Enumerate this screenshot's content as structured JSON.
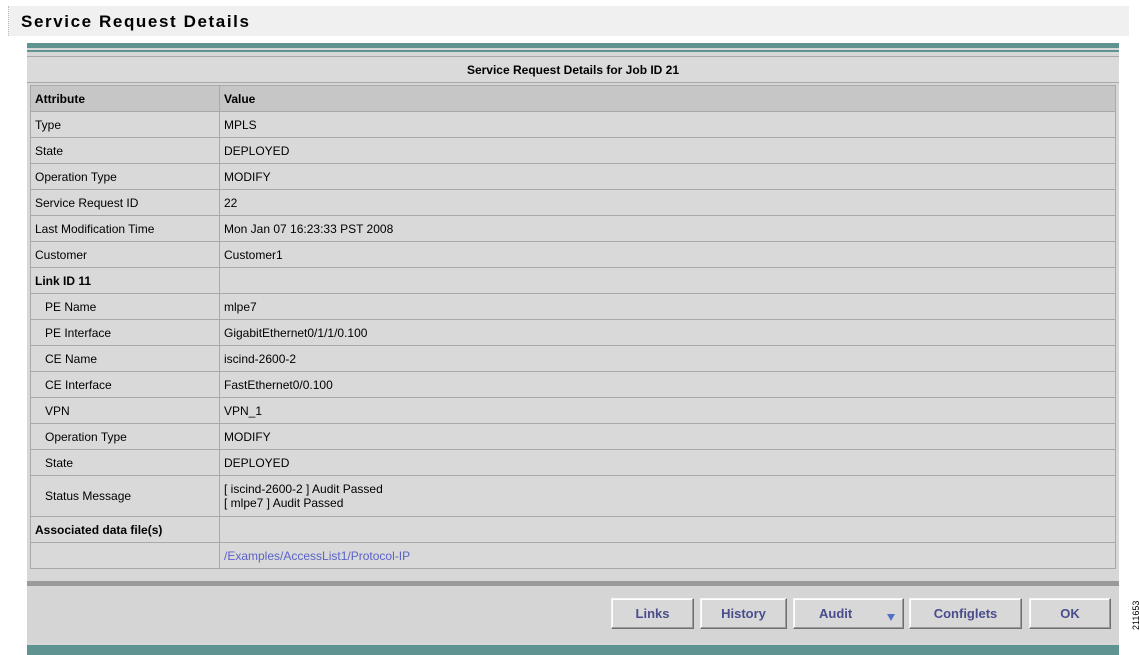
{
  "page": {
    "title": "Service Request Details"
  },
  "table": {
    "caption": "Service Request Details for Job ID 21",
    "header": {
      "attribute": "Attribute",
      "value": "Value"
    },
    "rows": [
      {
        "attribute": "Type",
        "value": "MPLS"
      },
      {
        "attribute": "State",
        "value": "DEPLOYED"
      },
      {
        "attribute": "Operation Type",
        "value": "MODIFY"
      },
      {
        "attribute": "Service Request ID",
        "value": "22"
      },
      {
        "attribute": "Last Modification Time",
        "value": "Mon Jan 07 16:23:33 PST 2008"
      },
      {
        "attribute": "Customer",
        "value": "Customer1"
      },
      {
        "attribute": "Link ID 11",
        "value": ""
      },
      {
        "attribute": "PE Name",
        "value": "mlpe7"
      },
      {
        "attribute": "PE Interface",
        "value": "GigabitEthernet0/1/1/0.100"
      },
      {
        "attribute": "CE Name",
        "value": "iscind-2600-2"
      },
      {
        "attribute": "CE Interface",
        "value": "FastEthernet0/0.100"
      },
      {
        "attribute": "VPN",
        "value": "VPN_1"
      },
      {
        "attribute": "Operation Type",
        "value": "MODIFY"
      },
      {
        "attribute": "State",
        "value": "DEPLOYED"
      },
      {
        "attribute": "Status Message",
        "value_line1": "[ iscind-2600-2 ] Audit Passed",
        "value_line2": "[ mlpe7 ] Audit Passed"
      },
      {
        "attribute": "Associated data file(s)",
        "value": ""
      },
      {
        "attribute": "",
        "value": "/Examples/AccessList1/Protocol-IP"
      }
    ]
  },
  "buttons": {
    "links": "Links",
    "history": "History",
    "audit": "Audit",
    "configlets": "Configlets",
    "ok": "OK"
  },
  "side_label": "211653",
  "colors": {
    "accent_teal": "#5e9391",
    "link": "#5a62c8",
    "button_text": "#4a4d8c"
  },
  "icons": {
    "audit_dropdown": "chevron-down-icon"
  }
}
